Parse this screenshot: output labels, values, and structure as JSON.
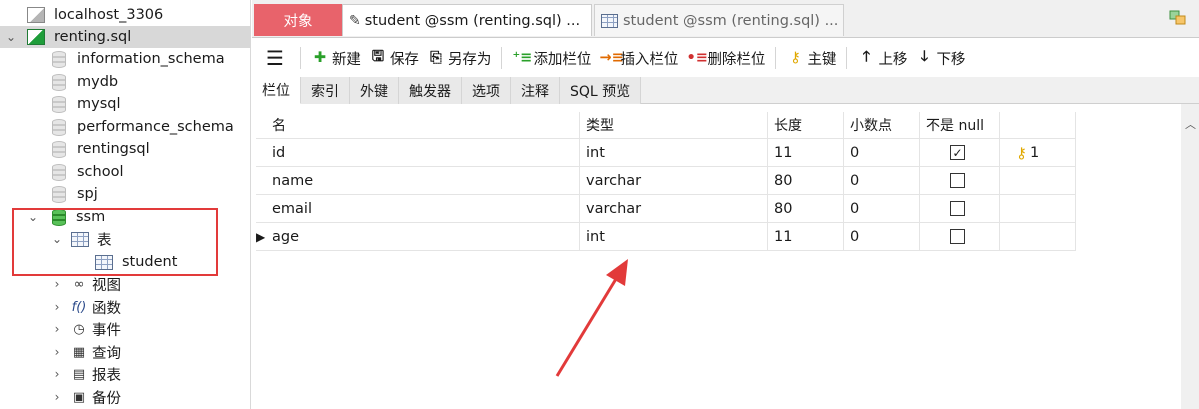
{
  "sidebar": {
    "items": [
      {
        "label": "localhost_3306",
        "icon": "connection-icon"
      },
      {
        "label": "renting.sql",
        "icon": "connection-active-icon"
      },
      {
        "label": "information_schema",
        "icon": "database-icon"
      },
      {
        "label": "mydb",
        "icon": "database-icon"
      },
      {
        "label": "mysql",
        "icon": "database-icon"
      },
      {
        "label": "performance_schema",
        "icon": "database-icon"
      },
      {
        "label": "rentingsql",
        "icon": "database-icon"
      },
      {
        "label": "school",
        "icon": "database-icon"
      },
      {
        "label": "spj",
        "icon": "database-icon"
      },
      {
        "label": "ssm",
        "icon": "database-open-icon"
      },
      {
        "label": "表",
        "icon": "tables-icon"
      },
      {
        "label": "student",
        "icon": "table-icon"
      },
      {
        "label": "视图",
        "icon": "views-icon"
      },
      {
        "label": "函数",
        "icon": "functions-icon"
      },
      {
        "label": "事件",
        "icon": "events-icon"
      },
      {
        "label": "查询",
        "icon": "queries-icon"
      },
      {
        "label": "报表",
        "icon": "reports-icon"
      },
      {
        "label": "备份",
        "icon": "backups-icon"
      }
    ]
  },
  "tabs": {
    "objects": "对象",
    "active": "student @ssm (renting.sql) ...",
    "inactive": "student @ssm (renting.sql) ..."
  },
  "toolbar": {
    "menu_icon": "☰",
    "new": "新建",
    "save": "保存",
    "save_as": "另存为",
    "add_field": "添加栏位",
    "insert_field": "插入栏位",
    "delete_field": "删除栏位",
    "primary_key": "主键",
    "move_up": "上移",
    "move_down": "下移"
  },
  "subtabs": [
    "栏位",
    "索引",
    "外键",
    "触发器",
    "选项",
    "注释",
    "SQL 预览"
  ],
  "grid": {
    "headers": {
      "name": "名",
      "type": "类型",
      "length": "长度",
      "decimals": "小数点",
      "not_null": "不是 null"
    },
    "rows": [
      {
        "name": "id",
        "type": "int",
        "length": "11",
        "decimals": "0",
        "not_null": true,
        "key": "1"
      },
      {
        "name": "name",
        "type": "varchar",
        "length": "80",
        "decimals": "0",
        "not_null": false,
        "key": ""
      },
      {
        "name": "email",
        "type": "varchar",
        "length": "80",
        "decimals": "0",
        "not_null": false,
        "key": ""
      },
      {
        "name": "age",
        "type": "int",
        "length": "11",
        "decimals": "0",
        "not_null": false,
        "key": ""
      }
    ]
  },
  "colors": {
    "objects_tab": "#e8636b",
    "highlight_box": "#e23a3a",
    "annotation_arrow": "#e23a3a"
  }
}
